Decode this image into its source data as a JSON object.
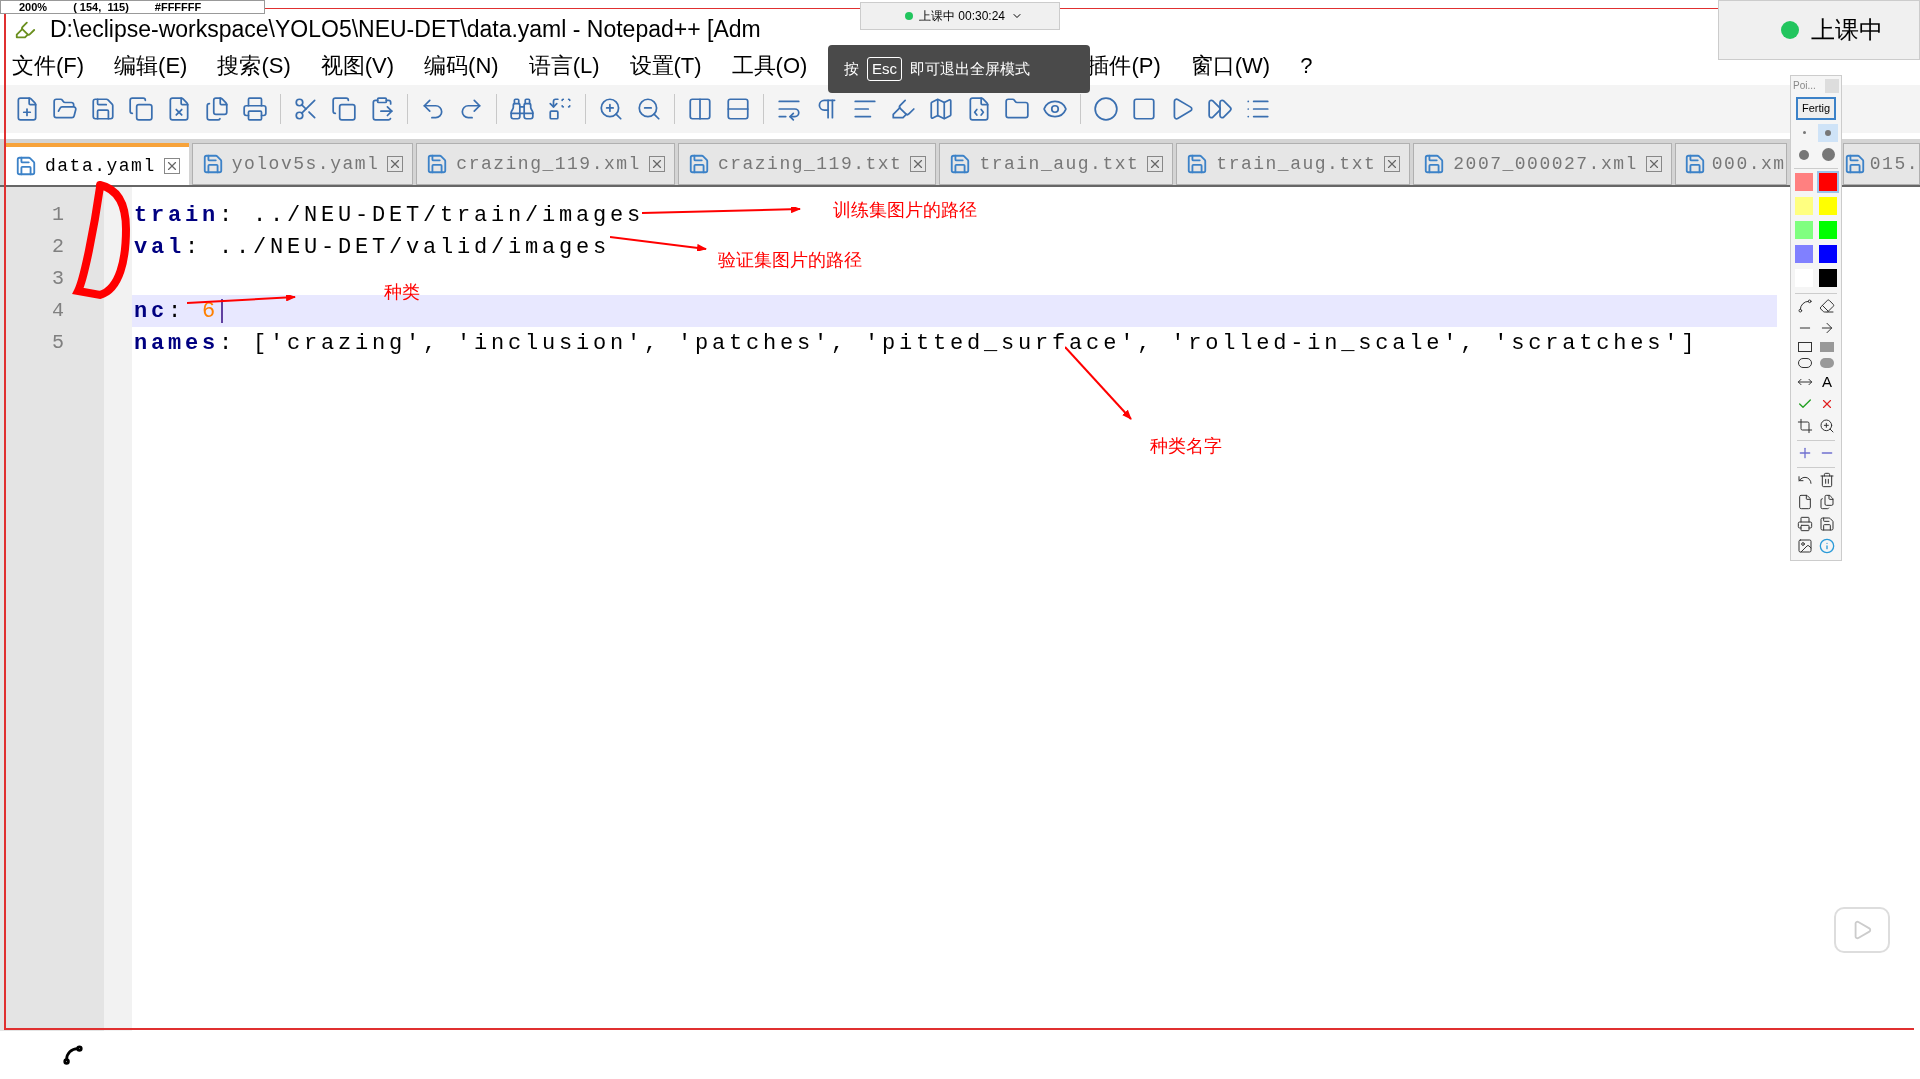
{
  "screen_overlay": {
    "zoom": "200%",
    "coords": "( 154,  115)",
    "color_value": "#FFFFFF"
  },
  "window": {
    "title": "D:\\eclipse-workspace\\YOLO5\\NEU-DET\\data.yaml - Notepad++ [Adm"
  },
  "class_timer": {
    "status": "上课中 00:30:24"
  },
  "class_status_widget": {
    "label": "上课中"
  },
  "fullscreen_toast": {
    "prefix": "按",
    "key": "Esc",
    "message": "即可退出全屏模式"
  },
  "menu": [
    "文件(F)",
    "编辑(E)",
    "搜索(S)",
    "视图(V)",
    "编码(N)",
    "语言(L)",
    "设置(T)",
    "工具(O)",
    "插件(P)",
    "窗口(W)",
    "?"
  ],
  "tabs": [
    {
      "label": "data.yaml",
      "selected": true
    },
    {
      "label": "yolov5s.yaml",
      "selected": false
    },
    {
      "label": "crazing_119.xml",
      "selected": false
    },
    {
      "label": "crazing_119.txt",
      "selected": false
    },
    {
      "label": "train_aug.txt",
      "selected": false
    },
    {
      "label": "train_aug.txt",
      "selected": false
    },
    {
      "label": "2007_000027.xml",
      "selected": false
    },
    {
      "label": "000.xm",
      "selected": false
    },
    {
      "label": "015.",
      "selected": false
    }
  ],
  "editor": {
    "lines": [
      {
        "number": "1",
        "current": false,
        "tokens": [
          {
            "kind": "key",
            "text": "train"
          },
          {
            "kind": "plain",
            "text": ": ../NEU-DET/train/images"
          }
        ]
      },
      {
        "number": "2",
        "current": false,
        "tokens": [
          {
            "kind": "key",
            "text": "val"
          },
          {
            "kind": "plain",
            "text": ": ../NEU-DET/valid/images"
          }
        ]
      },
      {
        "number": "3",
        "current": false
      },
      {
        "number": "4",
        "current": true,
        "tokens": [
          {
            "kind": "key",
            "text": "nc"
          },
          {
            "kind": "plain",
            "text": ": "
          },
          {
            "kind": "number",
            "text": "6"
          }
        ]
      },
      {
        "number": "5",
        "current": false,
        "tokens": [
          {
            "kind": "key",
            "text": "names"
          },
          {
            "kind": "plain",
            "text": ": ['crazing', 'inclusion', 'patches', 'pitted_surface', 'rolled-in_scale', 'scratches']"
          }
        ]
      }
    ]
  },
  "annotations": [
    "训练集图片的路径",
    "验证集图片的路径",
    "种类",
    "种类名字"
  ],
  "palette": {
    "title": "Poi...",
    "done_button": "Fertig",
    "text_tool": "A",
    "pen_sizes": [
      {
        "selected": false
      },
      {
        "selected": true
      },
      {
        "selected": false
      },
      {
        "selected": false
      }
    ],
    "colors": [
      {
        "color": "#ff8080",
        "selected": false
      },
      {
        "color": "#ff0000",
        "selected": true
      },
      {
        "color": "#ffff80",
        "selected": false
      },
      {
        "color": "#ffff00",
        "selected": false
      },
      {
        "color": "#80ff80",
        "selected": false
      },
      {
        "color": "#00ff00",
        "selected": false
      },
      {
        "color": "#8080ff",
        "selected": false
      },
      {
        "color": "#0000ff",
        "selected": false
      },
      {
        "color": "#ffffff",
        "selected": false
      },
      {
        "color": "#000000",
        "selected": false
      }
    ]
  }
}
